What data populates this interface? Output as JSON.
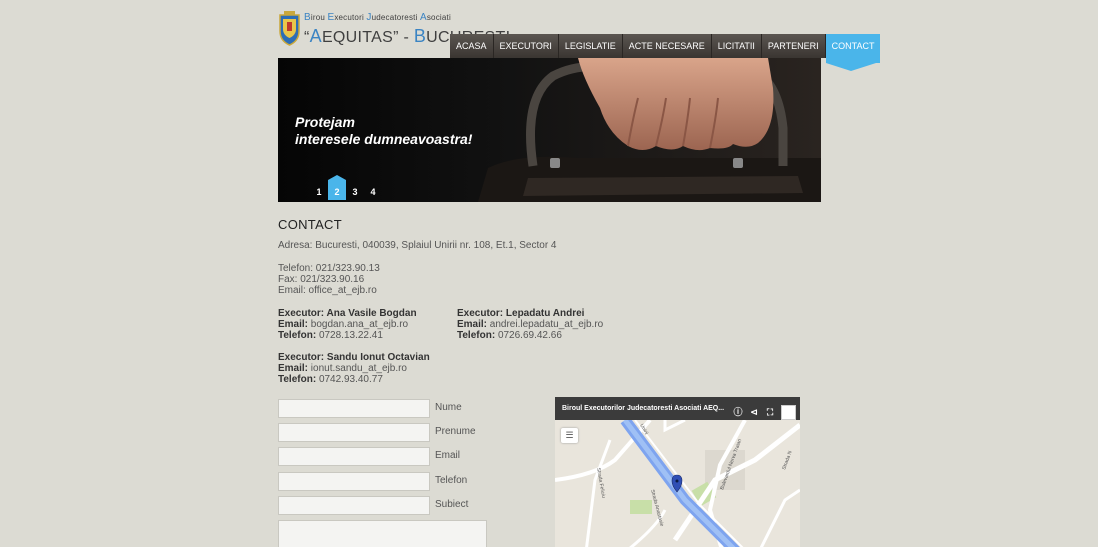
{
  "header": {
    "logo_line1_parts": [
      {
        "cap": "B",
        "rest": "irou "
      },
      {
        "cap": "E",
        "rest": "xecutori "
      },
      {
        "cap": "J",
        "rest": "udecatoresti "
      },
      {
        "cap": "A",
        "rest": "sociati"
      }
    ],
    "logo_line2": {
      "q1": "“",
      "cap1": "A",
      "rest1": "EQUITAS” - ",
      "cap2": "B",
      "rest2": "UCURESTI"
    }
  },
  "nav": {
    "items": [
      "ACASA",
      "EXECUTORI",
      "LEGISLATIE",
      "ACTE NECESARE",
      "LICITATII",
      "PARTENERI",
      "CONTACT"
    ],
    "active_index": 6
  },
  "slider": {
    "caption_line1": "Protejam",
    "caption_line2": "interesele dumneavoastra!",
    "dots": [
      "1",
      "2",
      "3",
      "4"
    ],
    "active_dot": 1
  },
  "contact": {
    "title": "CONTACT",
    "address": "Adresa: Bucuresti, 040039, Splaiul Unirii nr. 108, Et.1, Sector 4",
    "phone": "Telefon: 021/323.90.13",
    "fax": "Fax: 021/323.90.16",
    "email": "Email: office_at_ejb.ro",
    "executors": [
      {
        "name": "Executor: Ana Vasile Bogdan",
        "email_label": "Email:",
        "email": "bogdan.ana_at_ejb.ro",
        "phone_label": "Telefon:",
        "phone": "0728.13.22.41"
      },
      {
        "name": "Executor: Lepadatu Andrei",
        "email_label": "Email:",
        "email": "andrei.lepadatu_at_ejb.ro",
        "phone_label": "Telefon:",
        "phone": "0726.69.42.66"
      },
      {
        "name": "Executor: Sandu Ionut Octavian",
        "email_label": "Email:",
        "email": "ionut.sandu_at_ejb.ro",
        "phone_label": "Telefon:",
        "phone": "0742.93.40.77"
      }
    ]
  },
  "form": {
    "fields": [
      {
        "label": "Nume",
        "value": ""
      },
      {
        "label": "Prenume",
        "value": ""
      },
      {
        "label": "Email",
        "value": ""
      },
      {
        "label": "Telefon",
        "value": ""
      },
      {
        "label": "Subiect",
        "value": ""
      }
    ]
  },
  "map": {
    "title": "Biroul Executorilor Judecatoresti Asociati AEQ...",
    "icons": [
      "info-icon",
      "share-icon",
      "fullscreen-icon",
      "avatar"
    ],
    "streets": [
      "Strada Sf. Ioan",
      "Bulevardul Nerva Traian",
      "Strada Anastasie",
      "Strada Nicolae",
      "Strada Feliciu",
      "Unirii"
    ]
  },
  "colors": {
    "accent": "#4ab5ea",
    "background": "#dcdbd3",
    "nav_dark": "#3a3531"
  }
}
